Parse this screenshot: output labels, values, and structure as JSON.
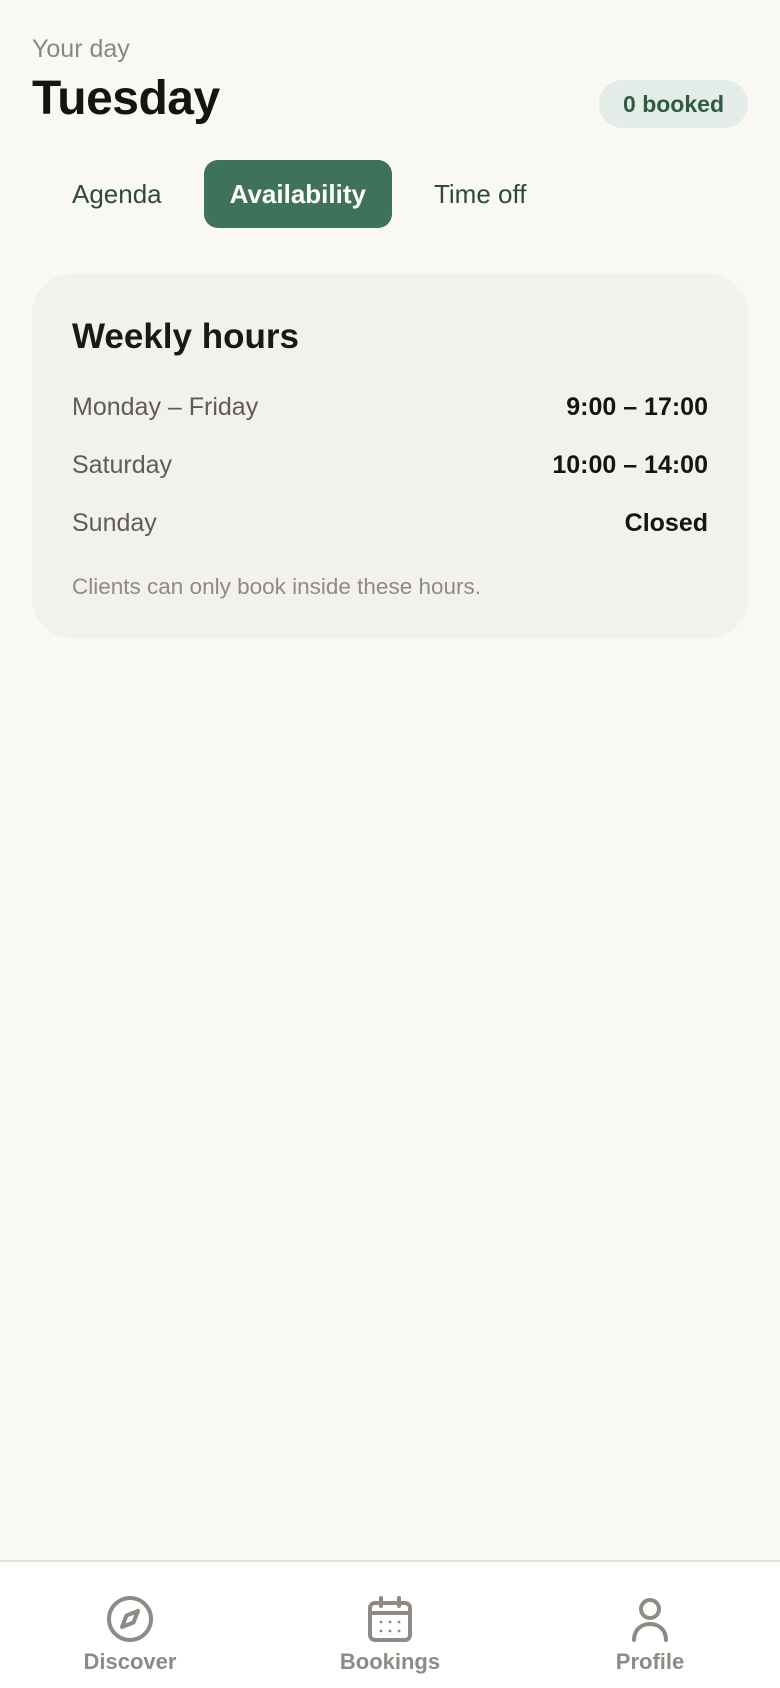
{
  "header": {
    "eyebrow": "Your day",
    "title": "Tuesday",
    "badge": "0 booked"
  },
  "tabs": [
    {
      "label": "Agenda",
      "active": false
    },
    {
      "label": "Availability",
      "active": true
    },
    {
      "label": "Time off",
      "active": false
    }
  ],
  "weekly_hours": {
    "title": "Weekly hours",
    "rows": [
      {
        "day": "Monday – Friday",
        "hours": "9:00 – 17:00"
      },
      {
        "day": "Saturday",
        "hours": "10:00 – 14:00"
      },
      {
        "day": "Sunday",
        "hours": "Closed"
      }
    ],
    "note": "Clients can only book inside these hours."
  },
  "bottom_nav": [
    {
      "label": "Discover",
      "icon": "compass-icon"
    },
    {
      "label": "Bookings",
      "icon": "calendar-icon"
    },
    {
      "label": "Profile",
      "icon": "user-icon"
    }
  ],
  "colors": {
    "background": "#f9f8f5",
    "accent": "#3f725a",
    "badge_bg": "#e3ece6",
    "card_bg": "#f3f1eb"
  }
}
